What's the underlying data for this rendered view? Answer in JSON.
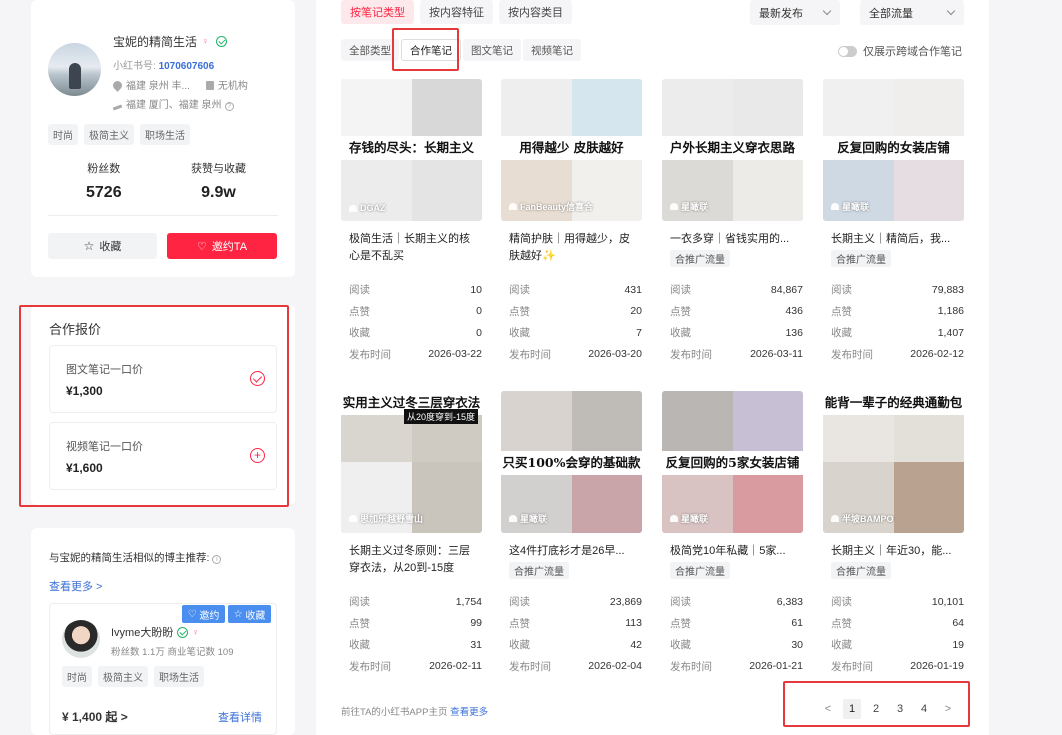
{
  "profile": {
    "name": "宝妮的精简生活",
    "id_label": "小红书号:",
    "id_value": "1070607606",
    "location": "福建 泉州 丰...",
    "mcn": "无机构",
    "route": "福建 厦门、福建 泉州",
    "tags": [
      "时尚",
      "极简主义",
      "职场生活"
    ],
    "followers_label": "粉丝数",
    "followers_value": "5726",
    "likes_label": "获赞与收藏",
    "likes_value": "9.9w",
    "fav_button": "收藏",
    "invite_button": "邀约TA"
  },
  "quote": {
    "title": "合作报价",
    "items": [
      {
        "name": "图文笔记一口价",
        "price": "¥1,300"
      },
      {
        "name": "视频笔记一口价",
        "price": "¥1,600"
      }
    ]
  },
  "recommend": {
    "title": "与宝妮的精简生活相似的博主推荐:",
    "more": "查看更多 >",
    "invite_btn": "邀约",
    "fav_btn": "收藏",
    "name": "Ivyme大盼盼",
    "stats": "粉丝数 1.1万   商业笔记数 109",
    "tags": [
      "时尚",
      "极简主义",
      "职场生活"
    ],
    "price": "¥ 1,400 起 >",
    "detail": "查看详情"
  },
  "filters": {
    "tabs": [
      "按笔记类型",
      "按内容特征",
      "按内容类目"
    ],
    "sort": "最新发布",
    "traffic": "全部流量",
    "subtabs": [
      "全部类型",
      "合作笔记",
      "图文笔记",
      "视频笔记"
    ],
    "toggle_label": "仅展示跨域合作笔记"
  },
  "metric_labels": {
    "read": "阅读",
    "like": "点赞",
    "fav": "收藏",
    "date": "发布时间"
  },
  "notes": [
    {
      "cover_text": "存钱的尽头：长期主义",
      "wm": "DGAZ",
      "title1": "极简生活｜长期主义的核",
      "title2": "心是不乱买",
      "badge": "",
      "read": "10",
      "like": "0",
      "fav": "0",
      "date": "2026-03-22"
    },
    {
      "cover_text": "用得越少 皮肤越好",
      "wm": "FanBeauty信喜合",
      "title1": "精简护肤｜用得越少，皮",
      "title2": "肤越好✨",
      "badge": "",
      "read": "431",
      "like": "20",
      "fav": "7",
      "date": "2026-03-20"
    },
    {
      "cover_text": "户外长期主义穿衣思路",
      "wm": "星瞰联",
      "title1": "一衣多穿｜省钱实用的...",
      "title2": "",
      "badge": "合推广流量",
      "read": "84,867",
      "like": "436",
      "fav": "136",
      "date": "2026-03-11"
    },
    {
      "cover_text": "反复回购的女装店铺",
      "wm": "星瞰联",
      "title1": "长期主义｜精简后，我...",
      "title2": "",
      "badge": "合推广流量",
      "read": "79,883",
      "like": "1,186",
      "fav": "1,407",
      "date": "2026-02-12"
    },
    {
      "cover_text": "实用主义过冬三层穿衣法",
      "sub_text": "从20度穿到-15度",
      "wm": "思加乐越野雪山",
      "title1": "长期主义过冬原则：三层",
      "title2": "穿衣法，从20到-15度",
      "badge": "",
      "read": "1,754",
      "like": "99",
      "fav": "31",
      "date": "2026-02-11"
    },
    {
      "cover_text": "只买100%会穿的基础款",
      "wm": "星瞰联",
      "title1": "这4件打底衫才是26早...",
      "title2": "",
      "badge": "合推广流量",
      "read": "23,869",
      "like": "113",
      "fav": "42",
      "date": "2026-02-04"
    },
    {
      "cover_text": "反复回购的5家女装店铺",
      "wm": "星瞰联",
      "title1": "极简党10年私藏｜5家...",
      "title2": "",
      "badge": "合推广流量",
      "read": "6,383",
      "like": "61",
      "fav": "30",
      "date": "2026-01-21"
    },
    {
      "cover_text": "能背一辈子的经典通勤包",
      "wm": "半坡BAMPO",
      "title1": "长期主义｜年近30，能...",
      "title2": "",
      "badge": "合推广流量",
      "read": "10,101",
      "like": "64",
      "fav": "19",
      "date": "2026-01-19"
    }
  ],
  "footer": {
    "prefix": "前往TA的小红书APP主页",
    "link": "查看更多"
  },
  "pager": {
    "prev": "<",
    "pages": [
      "1",
      "2",
      "3",
      "4"
    ],
    "next": ">"
  }
}
